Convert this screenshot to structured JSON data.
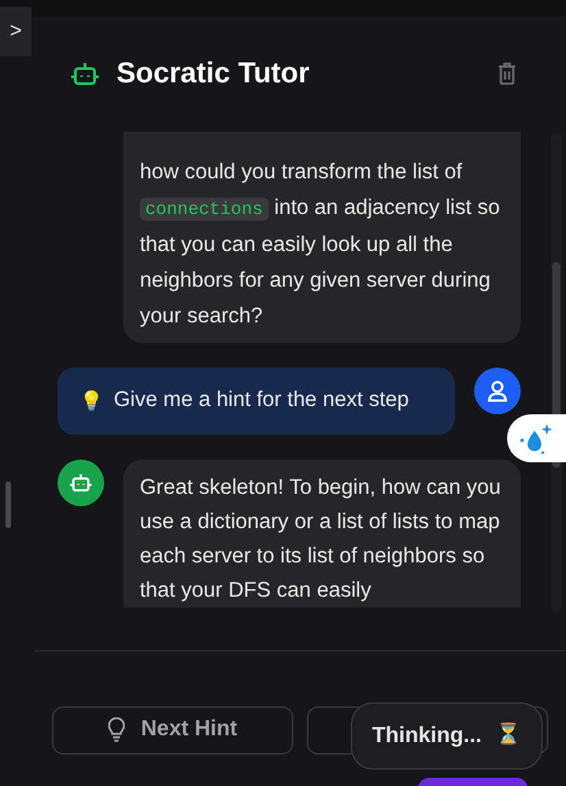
{
  "sidebar_toggle": {
    "label": ">"
  },
  "header": {
    "title": "Socratic Tutor"
  },
  "messages": [
    {
      "kind": "assistant",
      "avatar": false,
      "paragraph": [
        {
          "kind": "text",
          "text": "how could you transform the list of "
        },
        {
          "kind": "code",
          "text": "connections"
        },
        {
          "kind": "text",
          "text": " into an adjacency list so that you can easily look up all the neighbors for any given server during your search?"
        }
      ]
    },
    {
      "kind": "user",
      "avatar": true,
      "emoji": "💡",
      "paragraph": [
        {
          "kind": "text",
          "text": "Give me a hint for the next step"
        }
      ]
    },
    {
      "kind": "assistant",
      "avatar": true,
      "paragraph": [
        {
          "kind": "text",
          "text": "Great skeleton! To begin, how can you use a dictionary or a list of lists to map each server to its list of neighbors so that your DFS can easily"
        }
      ]
    }
  ],
  "buttons": [
    {
      "label": "Next Hint",
      "kind": "hint"
    },
    {
      "kind": "other"
    }
  ],
  "tooltip": {
    "text": "Thinking...",
    "emoji": "⏳"
  }
}
